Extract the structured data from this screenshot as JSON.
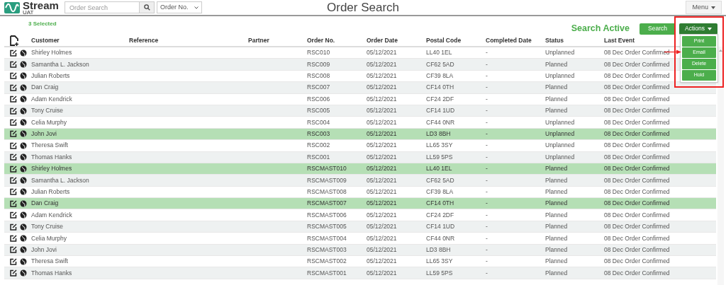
{
  "header": {
    "logo": {
      "name": "Stream",
      "sub": "UAT"
    },
    "search": {
      "placeholder": "Order Search"
    },
    "filter": {
      "value": "Order No."
    },
    "title": "Order Search",
    "menu": "Menu"
  },
  "toolbar": {
    "selected_count": "3 Selected",
    "status": "Search Active",
    "search_button": "Search",
    "actions": {
      "label": "Actions",
      "expanded": true,
      "items": [
        "Print",
        "Email",
        "Delete",
        "Hold"
      ]
    }
  },
  "table": {
    "columns": [
      "Customer",
      "Reference",
      "Partner",
      "Order No.",
      "Order Date",
      "Postal Code",
      "Completed Date",
      "Status",
      "Last Event"
    ],
    "rows": [
      {
        "customer": "Shirley Holmes",
        "order_no": "RSC010",
        "order_date": "05/12/2021",
        "postal_code": "LL40 1EL",
        "completed_date": "-",
        "status": "Unplanned",
        "last_event": "08 Dec Order Confirmed",
        "selected": false
      },
      {
        "customer": "Samantha L. Jackson",
        "order_no": "RSC009",
        "order_date": "05/12/2021",
        "postal_code": "CF62 5AD",
        "completed_date": "-",
        "status": "Planned",
        "last_event": "08 Dec Order Confirmed",
        "selected": false
      },
      {
        "customer": "Julian Roberts",
        "order_no": "RSC008",
        "order_date": "05/12/2021",
        "postal_code": "CF39 8LA",
        "completed_date": "-",
        "status": "Unplanned",
        "last_event": "08 Dec Order Confirmed",
        "selected": false
      },
      {
        "customer": "Dan Craig",
        "order_no": "RSC007",
        "order_date": "05/12/2021",
        "postal_code": "CF14 0TH",
        "completed_date": "-",
        "status": "Planned",
        "last_event": "08 Dec Order Confirmed",
        "selected": false
      },
      {
        "customer": "Adam Kendrick",
        "order_no": "RSC006",
        "order_date": "05/12/2021",
        "postal_code": "CF24 2DF",
        "completed_date": "-",
        "status": "Planned",
        "last_event": "08 Dec Order Confirmed",
        "selected": false
      },
      {
        "customer": "Tony Cruise",
        "order_no": "RSC005",
        "order_date": "05/12/2021",
        "postal_code": "CF14 1UD",
        "completed_date": "-",
        "status": "Planned",
        "last_event": "08 Dec Order Confirmed",
        "selected": false
      },
      {
        "customer": "Celia Murphy",
        "order_no": "RSC004",
        "order_date": "05/12/2021",
        "postal_code": "CF44 0NR",
        "completed_date": "-",
        "status": "Unplanned",
        "last_event": "08 Dec Order Confirmed",
        "selected": false
      },
      {
        "customer": "John Jovi",
        "order_no": "RSC003",
        "order_date": "05/12/2021",
        "postal_code": "LD3 8BH",
        "completed_date": "-",
        "status": "Unplanned",
        "last_event": "08 Dec Order Confirmed",
        "selected": true
      },
      {
        "customer": "Theresa Swift",
        "order_no": "RSC002",
        "order_date": "05/12/2021",
        "postal_code": "LL65 3SY",
        "completed_date": "-",
        "status": "Unplanned",
        "last_event": "08 Dec Order Confirmed",
        "selected": false
      },
      {
        "customer": "Thomas Hanks",
        "order_no": "RSC001",
        "order_date": "05/12/2021",
        "postal_code": "LL59 5PS",
        "completed_date": "-",
        "status": "Unplanned",
        "last_event": "08 Dec Order Confirmed",
        "selected": false
      },
      {
        "customer": "Shirley Holmes",
        "order_no": "RSCMAST010",
        "order_date": "05/12/2021",
        "postal_code": "LL40 1EL",
        "completed_date": "-",
        "status": "Planned",
        "last_event": "08 Dec Order Confirmed",
        "selected": true
      },
      {
        "customer": "Samantha L. Jackson",
        "order_no": "RSCMAST009",
        "order_date": "05/12/2021",
        "postal_code": "CF62 5AD",
        "completed_date": "-",
        "status": "Planned",
        "last_event": "08 Dec Order Confirmed",
        "selected": false
      },
      {
        "customer": "Julian Roberts",
        "order_no": "RSCMAST008",
        "order_date": "05/12/2021",
        "postal_code": "CF39 8LA",
        "completed_date": "-",
        "status": "Planned",
        "last_event": "08 Dec Order Confirmed",
        "selected": false
      },
      {
        "customer": "Dan Craig",
        "order_no": "RSCMAST007",
        "order_date": "05/12/2021",
        "postal_code": "CF14 0TH",
        "completed_date": "-",
        "status": "Planned",
        "last_event": "08 Dec Order Confirmed",
        "selected": true
      },
      {
        "customer": "Adam Kendrick",
        "order_no": "RSCMAST006",
        "order_date": "05/12/2021",
        "postal_code": "CF24 2DF",
        "completed_date": "-",
        "status": "Planned",
        "last_event": "08 Dec Order Confirmed",
        "selected": false
      },
      {
        "customer": "Tony Cruise",
        "order_no": "RSCMAST005",
        "order_date": "05/12/2021",
        "postal_code": "CF14 1UD",
        "completed_date": "-",
        "status": "Planned",
        "last_event": "08 Dec Order Confirmed",
        "selected": false
      },
      {
        "customer": "Celia Murphy",
        "order_no": "RSCMAST004",
        "order_date": "05/12/2021",
        "postal_code": "CF44 0NR",
        "completed_date": "-",
        "status": "Planned",
        "last_event": "08 Dec Order Confirmed",
        "selected": false
      },
      {
        "customer": "John Jovi",
        "order_no": "RSCMAST003",
        "order_date": "05/12/2021",
        "postal_code": "LD3 8BH",
        "completed_date": "-",
        "status": "Planned",
        "last_event": "08 Dec Order Confirmed",
        "selected": false
      },
      {
        "customer": "Theresa Swift",
        "order_no": "RSCMAST002",
        "order_date": "05/12/2021",
        "postal_code": "LL65 3SY",
        "completed_date": "-",
        "status": "Planned",
        "last_event": "08 Dec Order Confirmed",
        "selected": false
      },
      {
        "customer": "Thomas Hanks",
        "order_no": "RSCMAST001",
        "order_date": "05/12/2021",
        "postal_code": "LL59 5PS",
        "completed_date": "-",
        "status": "Planned",
        "last_event": "08 Dec Order Confirmed",
        "selected": false
      }
    ]
  }
}
